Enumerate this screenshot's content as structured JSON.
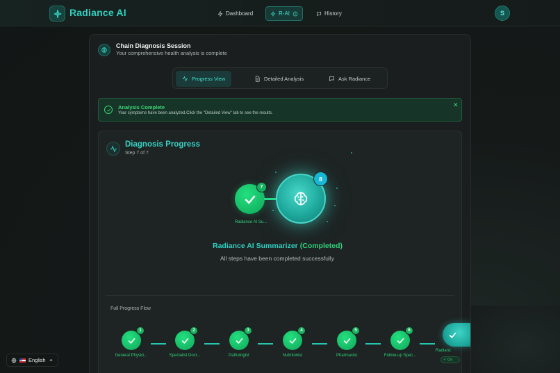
{
  "header": {
    "brand": "Radiance AI",
    "nav": [
      {
        "label": "Dashboard",
        "icon": "zap-icon"
      },
      {
        "label": "R-AI",
        "icon": "sparkle-icon",
        "active": true
      },
      {
        "label": "History",
        "icon": "message-icon"
      }
    ],
    "avatar_initial": "S"
  },
  "session": {
    "title": "Chain Diagnosis Session",
    "subtitle": "Your comprehensive health analysis is complete"
  },
  "tabs": [
    {
      "label": "Progress View",
      "icon": "activity-icon",
      "active": true
    },
    {
      "label": "Detailed Analysis",
      "icon": "document-icon"
    },
    {
      "label": "Ask Radiance",
      "icon": "chat-icon"
    }
  ],
  "alert": {
    "title": "Analysis Complete",
    "message": "Your symptoms have been analyzed.Click the \"Detailed View\" tab to see the results."
  },
  "progress": {
    "title": "Diagnosis Progress",
    "step_text": "Step 7 of 7",
    "prev_badge": "7",
    "current_badge": "8",
    "prev_label": "Radiance AI Su...",
    "current_name": "Radiance AI Summarizer",
    "current_status": "(Completed)",
    "summary": "All steps have been completed successfully",
    "flow_label": "Full Progress Flow",
    "flow": [
      {
        "num": "1",
        "label": "General Physici..."
      },
      {
        "num": "2",
        "label": "Specialist Doct..."
      },
      {
        "num": "3",
        "label": "Pathologist"
      },
      {
        "num": "4",
        "label": "Nutritionist"
      },
      {
        "num": "5",
        "label": "Pharmacist"
      },
      {
        "num": "6",
        "label": "Follow-up Spec..."
      }
    ],
    "flow_last_label": "Radianc",
    "flow_last_chip": "✓ Co"
  },
  "language": {
    "label": "English"
  },
  "colors": {
    "accent": "#2fd0c0",
    "success": "#2fd27c",
    "badge_current": "#16b8d6"
  }
}
